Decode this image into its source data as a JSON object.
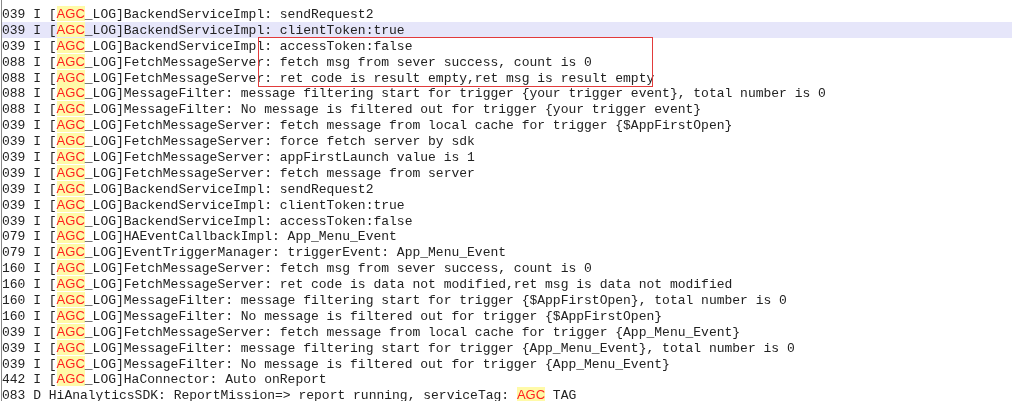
{
  "log_lines": [
    {
      "prefix": "039 I [",
      "tag": "AGC",
      "rest": "_LOG]BackendServiceImpl: sendRequest2",
      "selected": false
    },
    {
      "prefix": "039 I [",
      "tag": "AGC",
      "rest": "_LOG]BackendServiceImpl: clientToken:true",
      "selected": true
    },
    {
      "prefix": "039 I [",
      "tag": "AGC",
      "rest": "_LOG]BackendServiceImpl: accessToken:false",
      "selected": false
    },
    {
      "prefix": "088 I [",
      "tag": "AGC",
      "rest": "_LOG]FetchMessageServer: fetch msg from sever success, count is 0",
      "selected": false
    },
    {
      "prefix": "088 I [",
      "tag": "AGC",
      "rest": "_LOG]FetchMessageServer: ret code is result empty,ret msg is result empty",
      "selected": false
    },
    {
      "prefix": "088 I [",
      "tag": "AGC",
      "rest": "_LOG]MessageFilter: message filtering start for trigger {your trigger event}, total number is 0",
      "selected": false
    },
    {
      "prefix": "088 I [",
      "tag": "AGC",
      "rest": "_LOG]MessageFilter: No message is filtered out for trigger {your trigger event}",
      "selected": false
    },
    {
      "prefix": "039 I [",
      "tag": "AGC",
      "rest": "_LOG]FetchMessageServer: fetch message from local cache for trigger {$AppFirstOpen}",
      "selected": false
    },
    {
      "prefix": "039 I [",
      "tag": "AGC",
      "rest": "_LOG]FetchMessageServer: force fetch server by sdk",
      "selected": false
    },
    {
      "prefix": "039 I [",
      "tag": "AGC",
      "rest": "_LOG]FetchMessageServer: appFirstLaunch value is 1",
      "selected": false
    },
    {
      "prefix": "039 I [",
      "tag": "AGC",
      "rest": "_LOG]FetchMessageServer: fetch message from server",
      "selected": false
    },
    {
      "prefix": "039 I [",
      "tag": "AGC",
      "rest": "_LOG]BackendServiceImpl: sendRequest2",
      "selected": false
    },
    {
      "prefix": "039 I [",
      "tag": "AGC",
      "rest": "_LOG]BackendServiceImpl: clientToken:true",
      "selected": false
    },
    {
      "prefix": "039 I [",
      "tag": "AGC",
      "rest": "_LOG]BackendServiceImpl: accessToken:false",
      "selected": false
    },
    {
      "prefix": "079 I [",
      "tag": "AGC",
      "rest": "_LOG]HAEventCallbackImpl: App_Menu_Event",
      "selected": false
    },
    {
      "prefix": "079 I [",
      "tag": "AGC",
      "rest": "_LOG]EventTriggerManager: triggerEvent: App_Menu_Event",
      "selected": false
    },
    {
      "prefix": "160 I [",
      "tag": "AGC",
      "rest": "_LOG]FetchMessageServer: fetch msg from sever success, count is 0",
      "selected": false
    },
    {
      "prefix": "160 I [",
      "tag": "AGC",
      "rest": "_LOG]FetchMessageServer: ret code is data not modified,ret msg is data not modified",
      "selected": false
    },
    {
      "prefix": "160 I [",
      "tag": "AGC",
      "rest": "_LOG]MessageFilter: message filtering start for trigger {$AppFirstOpen}, total number is 0",
      "selected": false
    },
    {
      "prefix": "160 I [",
      "tag": "AGC",
      "rest": "_LOG]MessageFilter: No message is filtered out for trigger {$AppFirstOpen}",
      "selected": false
    },
    {
      "prefix": "039 I [",
      "tag": "AGC",
      "rest": "_LOG]FetchMessageServer: fetch message from local cache for trigger {App_Menu_Event}",
      "selected": false
    },
    {
      "prefix": "039 I [",
      "tag": "AGC",
      "rest": "_LOG]MessageFilter: message filtering start for trigger {App_Menu_Event}, total number is 0",
      "selected": false
    },
    {
      "prefix": "039 I [",
      "tag": "AGC",
      "rest": "_LOG]MessageFilter: No message is filtered out for trigger {App_Menu_Event}",
      "selected": false
    },
    {
      "prefix": "442 I [",
      "tag": "AGC",
      "rest": "_LOG]HaConnector: Auto onReport",
      "selected": false
    },
    {
      "prefix": "083 D HiAnalyticsSDK: ReportMission=> report running, serviceTag: ",
      "tag": "AGC",
      "rest": " TAG",
      "selected": false
    }
  ]
}
